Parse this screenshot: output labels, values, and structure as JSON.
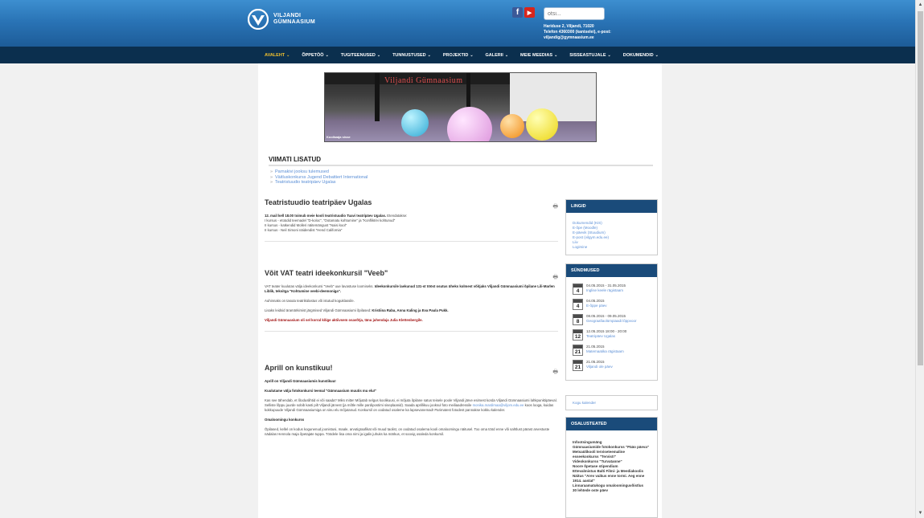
{
  "header": {
    "logo_line1": "VILJANDI",
    "logo_line2": "GÜMNAASIUM",
    "search_placeholder": "otsi...",
    "contact_line1": "Hariduse 2, Viljandi, 71020",
    "contact_line2": "Telefon 4360300 (kantselei), e-post:",
    "contact_line3": "viljandig@gymnaasium.ee"
  },
  "menu": [
    {
      "label": "AVALEHT",
      "active": true
    },
    {
      "label": "ÕPPETÖÖ",
      "active": false
    },
    {
      "label": "TUGITEENUSED",
      "active": false
    },
    {
      "label": "TUNNUSTUSED",
      "active": false
    },
    {
      "label": "PROJEKTID",
      "active": false
    },
    {
      "label": "GALERII",
      "active": false
    },
    {
      "label": "MEIE MEEDIAS",
      "active": false
    },
    {
      "label": "SISSEASTUJALE",
      "active": false
    },
    {
      "label": "DOKUMENDID",
      "active": false
    }
  ],
  "banner": {
    "sign": "Viljandi Gümnaasium",
    "caption": "Kooliмaja sisse"
  },
  "recent": {
    "title": "VIIMATI LISATUD",
    "links": [
      "Parnakivi jooksu tulemused",
      "Väitluskonkurss Jugend Debattiert International",
      "Teatristuudio teatripäev Ugalas"
    ]
  },
  "articles": [
    {
      "title": "Teatristuudio teatripäev Ugalas",
      "p1": "12. mail kell 18.00 toimub meie kooli teatristuudio Tuavi teatripäev Ugalas.",
      "p1b": " Etendatakse:",
      "p2": "I kursus - etüüdid teemadel \"D-koloc\", \"Ootamatu kohtumine\" ja \"Konflikt/ei kohtunud\"",
      "p3": "II kursus - katkendid Molleri näitemängust \"Naisi kool\"",
      "p4": "II kursus - Neil Simoni näidendist \"Hend California\""
    },
    {
      "title": "Võit VAT teatri ideekonkursil \"Veeb\"",
      "p1": "VAT teater kuulutas välja ideekonkursi \"Veeb\" uue lavastuse loomiseks. ",
      "p1b": "Ideekonkursile laekunud 131-st tööst osutus üheks kolmest võitjaks Viljandi Gümnaasiumi õpilane Lili-Marlen Liblik, teksitga \"Kohtumine veebi-deemoniga\".",
      "p2": "Auhinnaks on tasuta teatrikülastus või istutud koguklassile.",
      "p3": "Lisaks leidsid äramärkimist järgmised Viljandi Gümnaasiumi õpilased: ",
      "p3b": "Kristiina Raba, Anna Kaling ja Eva Paula Pukk.",
      "p4": "Viljandi Gümnaasium oli sel korral kõige aktiivsem osavõtja, tänu juhendaja Julia Klettenbergile."
    },
    {
      "title": "Aprill on kunstikuu!",
      "p1": "Aprill on Viljandi Gümnaasiumis kunstikuu!",
      "p2": "Kuulutame välja fotokonkursi teemal \"Gümnaasium muutis mu elu!\"",
      "p3": "Kas see tähendab, et lõoduslihtid ei või saada? Miks mitte! Mõjutab selgus koolikuusi, ei mõjuta õpilane satus teisele poole Viljandi järve esimest korda Viljandi Gümnaasiumi lahkpunktipäeval. Selliste lõppu juurde sobib kasti pilt Viljandi järvest (ja mõtle mille pardipostimi siseplaanid). Saada aprillikuu jooksul foto meiliaadressile ",
      "p3link": "monika.mardimaa@viljom.edu.ee",
      "p3c": " koos looga, kuidas kokkupuude Viljandi Gümnaasiumiga on sinu elu mõjutanud. Konkursil on oodatud osaleme ka lapsevanemad! Parimatest fotodest pannakse kokku kalender.",
      "p4": "Omaloomingu konkurss",
      "p5": "Õpilased, kellel on kodus kogunenud joonistusi, maale, arvutigraafikat või muud taolist, on oodatud osalema kooli omaloomingu näitusel. Too oma tööd enne või sahtlust pärast arvestuste nädalas Hennola maja õpetajate tuppa. Töödele lisa oma nimi ja igalis juhuks ka märkus, et sooviд osaleda konkursil."
    }
  ],
  "sidebar": {
    "lingid": {
      "title": "LINGID",
      "items": [
        "Dokumendid (KIS)",
        "E-õpe (Moodle)",
        "E-päevik (Stuudium)",
        "E-post (vilgym.edu.ee)",
        "Liiv",
        "Logimine"
      ]
    },
    "sundmused": {
      "title": "SÜNDMUSED",
      "events": [
        {
          "day": "4",
          "date": "04.05.2015 - 31.05.2015",
          "name": "Inglise keele rägistaam"
        },
        {
          "day": "4",
          "date": "04.05.2015",
          "name": "E-õppe päev"
        },
        {
          "day": "8",
          "date": "08.05.2015 - 09.05.2015",
          "name": "Geograafiaolümpiaadi lõppvoor"
        },
        {
          "day": "12",
          "date": "12.05.2015 18:00 - 20:00",
          "name": "Teatripäev Ugalas"
        },
        {
          "day": "21",
          "date": "21.05.2015",
          "name": "Matemaatika rägistaam"
        },
        {
          "day": "21",
          "date": "21.05.2015",
          "name": "Viljandi ole päev"
        }
      ]
    },
    "calendar_link": "Kogu kalender",
    "osalusteated": {
      "title": "OSALUSTEATED",
      "items": [
        "Infootsingumäng",
        "Gümnaasiumide fotokonkurss \"Pääo päeva\"",
        "Metsaülikooli terviseteemaline esseekonkurss \"Tervist!\"",
        "Videokonkurss \"Turvatanne\"",
        "Noore õpetase stipendium",
        "Ettevalmistus Balti Filmi- ja Meediakoolis",
        "Näitus \"Arev vaikus enne tormi. Aeg enne 1914. aastat\"",
        "Linnaraamatukogu omaloominguvõistlus",
        "30 lehtede oste päev"
      ]
    }
  }
}
